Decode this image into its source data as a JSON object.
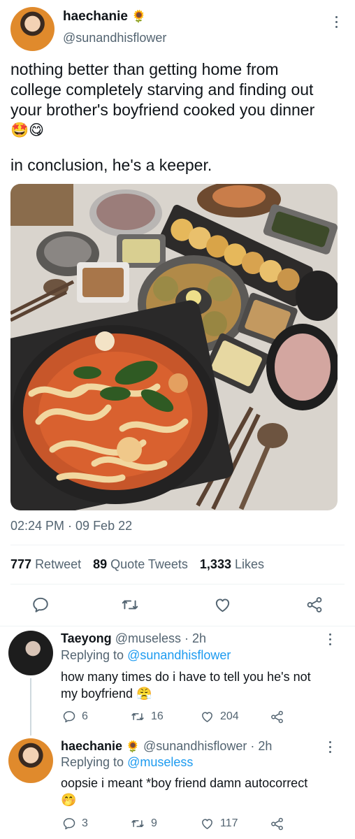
{
  "main_tweet": {
    "display_name": "haechanie",
    "name_emoji": "🌻",
    "handle": "@sunandhisflower",
    "text_line1": "nothing better than getting home from",
    "text_line2": "college completely starving and finding out",
    "text_line3": "your brother's boyfriend cooked you dinner",
    "text_emojis": "🤩😋",
    "text_conclusion": "in conclusion, he's a keeper.",
    "timestamp": "02:24 PM · 09 Feb 22",
    "retweets_count": "777",
    "retweets_label": "Retweet",
    "quotes_count": "89",
    "quotes_label": "Quote Tweets",
    "likes_count": "1,333",
    "likes_label": "Likes"
  },
  "replies": [
    {
      "display_name": "Taeyong",
      "handle": "@museless",
      "time": "· 2h",
      "replying_prefix": "Replying to",
      "replying_to": "@sunandhisflower",
      "text_line1": "how many times do i have to tell you he's not",
      "text_line2": "my boyfriend 😤",
      "reply_count": "6",
      "retweet_count": "16",
      "like_count": "204"
    },
    {
      "display_name": "haechanie",
      "name_emoji": "🌻",
      "handle": "@sunandhisflower",
      "time": "· 2h",
      "replying_prefix": "Replying to",
      "replying_to": "@museless",
      "text_line1": "oopsie i meant *boy friend damn autocorrect",
      "text_line2": "🤭",
      "reply_count": "3",
      "retweet_count": "9",
      "like_count": "117"
    }
  ],
  "icons": {
    "reply": "speech-bubble-icon",
    "retweet": "retweet-icon",
    "like": "heart-icon",
    "share": "share-icon",
    "more": "vertical-dots-icon"
  },
  "colors": {
    "text": "#0f1419",
    "muted": "#536471",
    "link": "#1d9bf0",
    "divider": "#eff3f4"
  }
}
